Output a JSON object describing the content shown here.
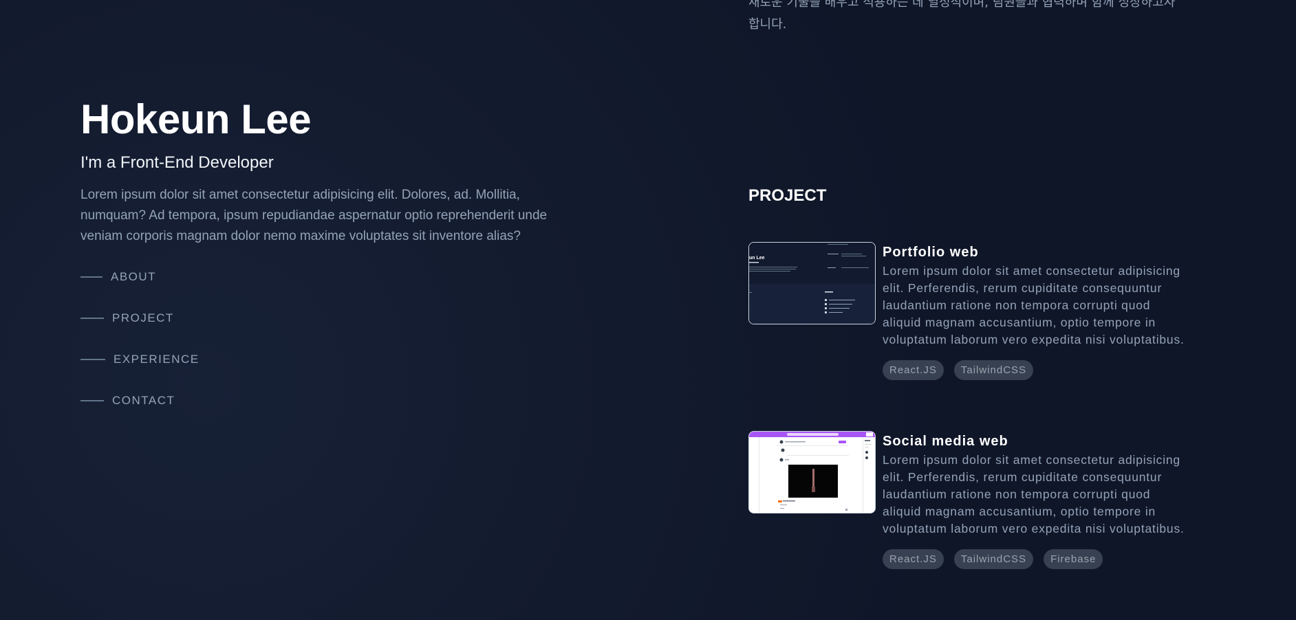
{
  "top_text": "새로운 기술을 배우고 적용하는 데 열정적이며, 팀원들과 협력하며 함께 성장하고자 합니다.",
  "profile": {
    "name": "Hokeun Lee",
    "role": "I'm a Front-End Developer",
    "intro": "Lorem ipsum dolor sit amet consectetur adipisicing elit. Dolores, ad. Mollitia, numquam? Ad tempora, ipsum repudiandae aspernatur optio reprehenderit unde veniam corporis magnam dolor nemo maxime voluptates sit inventore alias?"
  },
  "nav": [
    {
      "label": "ABOUT"
    },
    {
      "label": "PROJECT"
    },
    {
      "label": "EXPERIENCE"
    },
    {
      "label": "CONTACT"
    }
  ],
  "project_section": {
    "title": "PROJECT",
    "items": [
      {
        "title": "Portfolio web",
        "description": "Lorem ipsum dolor sit amet consectetur adipisicing elit. Perferendis, rerum cupiditate consequuntur laudantium ratione non tempora corrupti quod aliquid magnam accusantium, optio tempore in voluptatum laborum vero expedita nisi voluptatibus.",
        "tags": [
          "React.JS",
          "TailwindCSS"
        ]
      },
      {
        "title": "Social media web",
        "description": "Lorem ipsum dolor sit amet consectetur adipisicing elit. Perferendis, rerum cupiditate consequuntur laudantium ratione non tempora corrupti quod aliquid magnam accusantium, optio tempore in voluptatum laborum vero expedita nisi voluptatibus.",
        "tags": [
          "React.JS",
          "TailwindCSS",
          "Firebase"
        ]
      }
    ]
  },
  "thumbnails": {
    "portfolio_preview_text": "un Lee"
  },
  "colors": {
    "background": "#0f1628",
    "text_primary": "#ffffff",
    "text_muted": "#94a3b8",
    "tag_bg": "#374151",
    "social_accent": "#a855f7"
  }
}
